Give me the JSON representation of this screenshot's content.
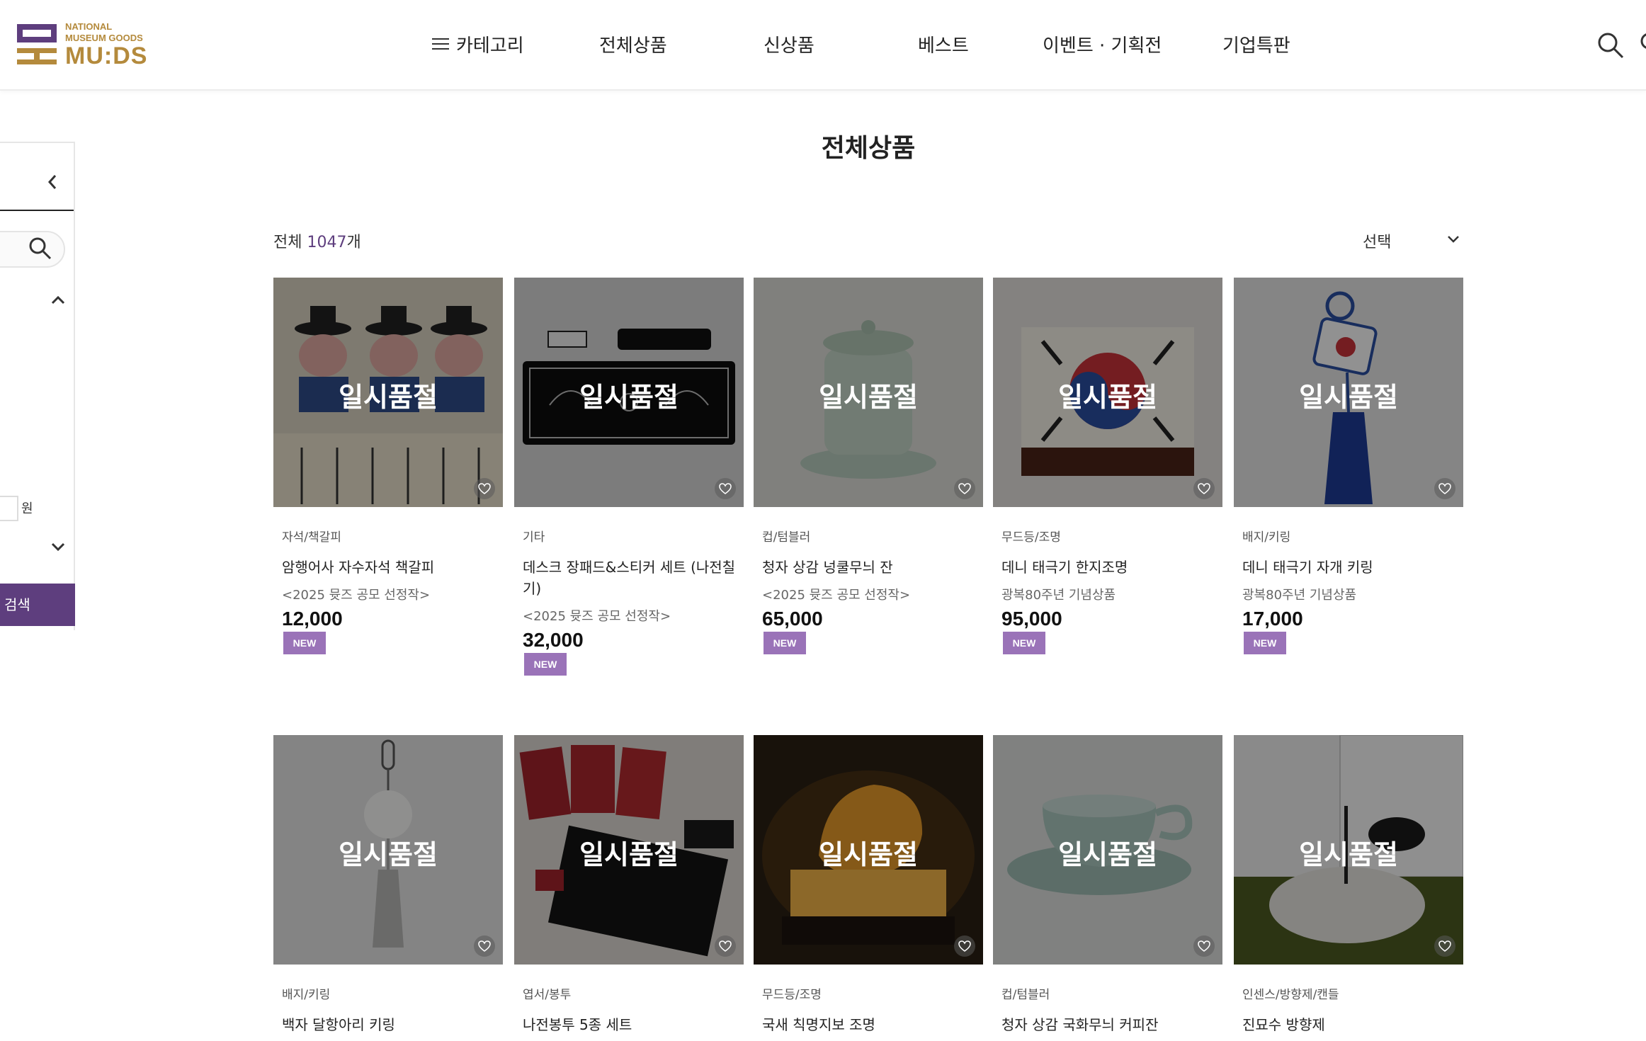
{
  "logo": {
    "line1": "NATIONAL",
    "line2": "MUSEUM GOODS",
    "brand": "MU:DS"
  },
  "nav": {
    "category": "카테고리",
    "all": "전체상품",
    "new": "신상품",
    "best": "베스트",
    "event": "이벤트 · 기획전",
    "corporate": "기업특판"
  },
  "sidebar": {
    "currency": "원",
    "search_button": "검색"
  },
  "main": {
    "title": "전체상품",
    "total_prefix": "전체 ",
    "total_count": "1047",
    "total_suffix": "개",
    "sort_label": "선택"
  },
  "products": [
    {
      "status": "일시품절",
      "category": "자석/책갈피",
      "name": "암행어사 자수자석 책갈피",
      "sub": "<2025 뮷즈 공모 선정작>",
      "price": "12,000",
      "badge": "NEW"
    },
    {
      "status": "일시품절",
      "category": "기타",
      "name": "데스크 장패드&스티커 세트 (나전칠기)",
      "sub": "<2025 뮷즈 공모 선정작>",
      "price": "32,000",
      "badge": "NEW"
    },
    {
      "status": "일시품절",
      "category": "컵/텀블러",
      "name": "청자 상감 넝쿨무늬 잔",
      "sub": "<2025 뮷즈 공모 선정작>",
      "price": "65,000",
      "badge": "NEW"
    },
    {
      "status": "일시품절",
      "category": "무드등/조명",
      "name": "데니 태극기 한지조명",
      "sub": "광복80주년 기념상품",
      "price": "95,000",
      "badge": "NEW"
    },
    {
      "status": "일시품절",
      "category": "배지/키링",
      "name": "데니 태극기 자개 키링",
      "sub": "광복80주년 기념상품",
      "price": "17,000",
      "badge": "NEW"
    },
    {
      "status": "일시품절",
      "category": "배지/키링",
      "name": "백자 달항아리 키링"
    },
    {
      "status": "일시품절",
      "category": "엽서/봉투",
      "name": "나전봉투 5종 세트"
    },
    {
      "status": "일시품절",
      "category": "무드등/조명",
      "name": "국새 칙명지보 조명"
    },
    {
      "status": "일시품절",
      "category": "컵/텀블러",
      "name": "청자 상감 국화무늬 커피잔"
    },
    {
      "status": "일시품절",
      "category": "인센스/방향제/캔들",
      "name": "진묘수 방향제"
    }
  ],
  "theme": {
    "accent": "#5e3e7e",
    "badge": "#9a73b8",
    "logo_gold": "#b48a3c"
  }
}
